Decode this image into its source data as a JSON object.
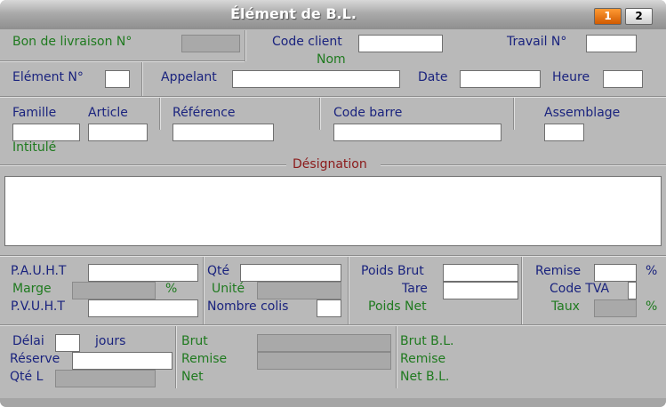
{
  "window": {
    "title": "Élément de B.L.",
    "tabs": [
      "1",
      "2"
    ]
  },
  "header": {
    "bon_livraison_label": "Bon de livraison N°",
    "code_client_label": "Code client",
    "nom_label": "Nom",
    "travail_label": "Travail N°"
  },
  "row2": {
    "element_label": "Elément N°",
    "appelant_label": "Appelant",
    "date_label": "Date",
    "heure_label": "Heure"
  },
  "row3": {
    "famille_label": "Famille",
    "article_label": "Article",
    "reference_label": "Référence",
    "code_barre_label": "Code barre",
    "assemblage_label": "Assemblage",
    "intitule_label": "Intitulé"
  },
  "designation_label": "Désignation",
  "prices": {
    "pauht_label": "P.A.U.H.T",
    "marge_label": "Marge",
    "marge_unit": "%",
    "pvuht_label": "P.V.U.H.T",
    "qte_label": "Qté",
    "unite_label": "Unité",
    "nombre_colis_label": "Nombre colis",
    "poids_brut_label": "Poids Brut",
    "tare_label": "Tare",
    "poids_net_label": "Poids Net",
    "remise_label": "Remise",
    "remise_unit": "%",
    "code_tva_label": "Code TVA",
    "taux_label": "Taux",
    "taux_unit": "%"
  },
  "totals": {
    "delai_label": "Délai",
    "jours_label": "jours",
    "reserve_label": "Réserve",
    "qte_l_label": "Qté L",
    "brut_label": "Brut",
    "remise_label": "Remise",
    "net_label": "Net",
    "brut_bl_label": "Brut B.L.",
    "remise_bl_label": "Remise",
    "net_bl_label": "Net B.L."
  }
}
